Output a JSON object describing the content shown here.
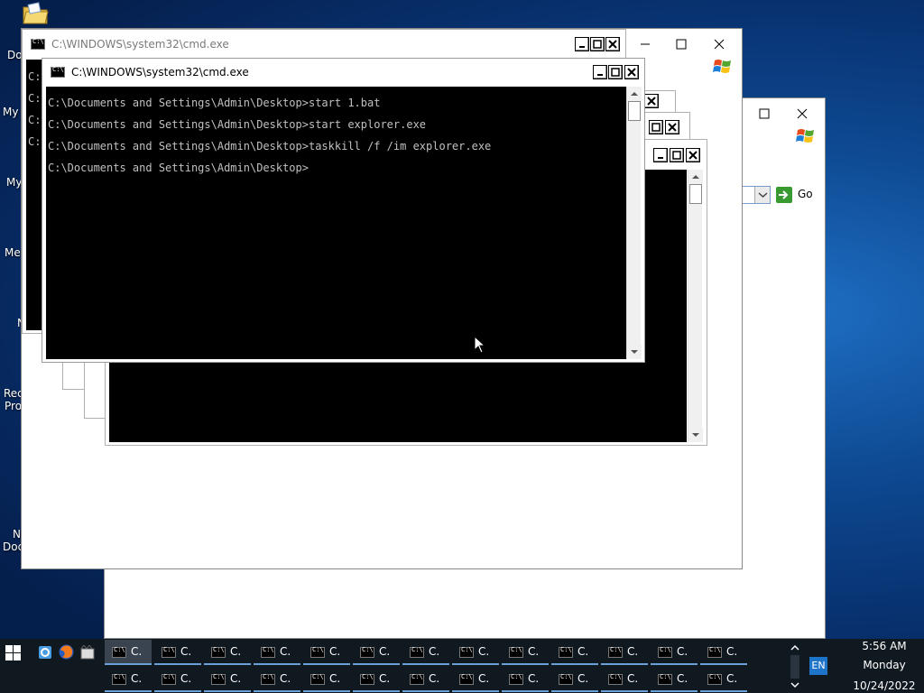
{
  "desktop": {
    "labels": [
      "Do",
      "My",
      "My",
      "Me",
      "N",
      "Rec",
      "Pro",
      "N",
      "Doc"
    ]
  },
  "windows": {
    "back_cmd": {
      "title": "C:\\WINDOWS\\system32\\cmd.exe",
      "partial_lines": [
        "C:",
        "C:",
        "C:",
        "C:"
      ]
    },
    "front_cmd": {
      "title": "C:\\WINDOWS\\system32\\cmd.exe",
      "lines": [
        "C:\\Documents and Settings\\Admin\\Desktop>start 1.bat",
        "C:\\Documents and Settings\\Admin\\Desktop>start explorer.exe",
        "C:\\Documents and Settings\\Admin\\Desktop>taskkill /f /im explorer.exe",
        "C:\\Documents and Settings\\Admin\\Desktop>"
      ]
    },
    "explorer": {
      "go_label": "Go"
    }
  },
  "taskbar": {
    "button_label": "C.",
    "buttons_row1_count": 13,
    "buttons_row2_count": 13,
    "language": "EN",
    "time": "5:56 AM",
    "day": "Monday",
    "date": "10/24/2022"
  },
  "colors": {
    "console_bg": "#000000",
    "console_text": "#c0c0c0",
    "taskbar_bg": "#101820",
    "language_bg": "#1e74c8"
  }
}
